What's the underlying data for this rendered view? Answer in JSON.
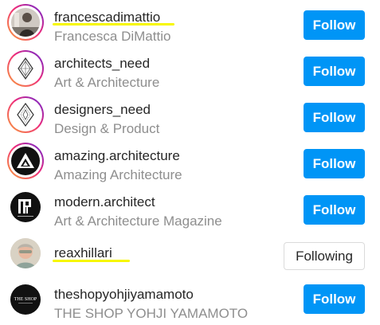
{
  "colors": {
    "follow_button": "#0095f6",
    "username_text": "#262626",
    "fullname_text": "#8e8e8e",
    "highlight": "#f7f700"
  },
  "rows": [
    {
      "username": "francescadimattio",
      "fullname": "Francesca DiMattio",
      "button": "Follow",
      "ring": true,
      "highlighted": true
    },
    {
      "username": "architects_need",
      "fullname": "Art & Architecture",
      "button": "Follow",
      "ring": true,
      "highlighted": false
    },
    {
      "username": "designers_need",
      "fullname": "Design & Product",
      "button": "Follow",
      "ring": true,
      "highlighted": false
    },
    {
      "username": "amazing.architecture",
      "fullname": "Amazing Architecture",
      "button": "Follow",
      "ring": true,
      "highlighted": false
    },
    {
      "username": "modern.architect",
      "fullname": "Art & Architecture Magazine",
      "button": "Follow",
      "ring": false,
      "highlighted": false
    },
    {
      "username": "reaxhillari",
      "fullname": "",
      "button": "Following",
      "ring": false,
      "highlighted": true
    },
    {
      "username": "theshopyohjiyamamoto",
      "fullname": "THE SHOP YOHJI YAMAMOTO",
      "button": "Follow",
      "ring": false,
      "highlighted": false
    }
  ],
  "avatar_texts": {
    "shop_logo": "THE SHOP"
  }
}
